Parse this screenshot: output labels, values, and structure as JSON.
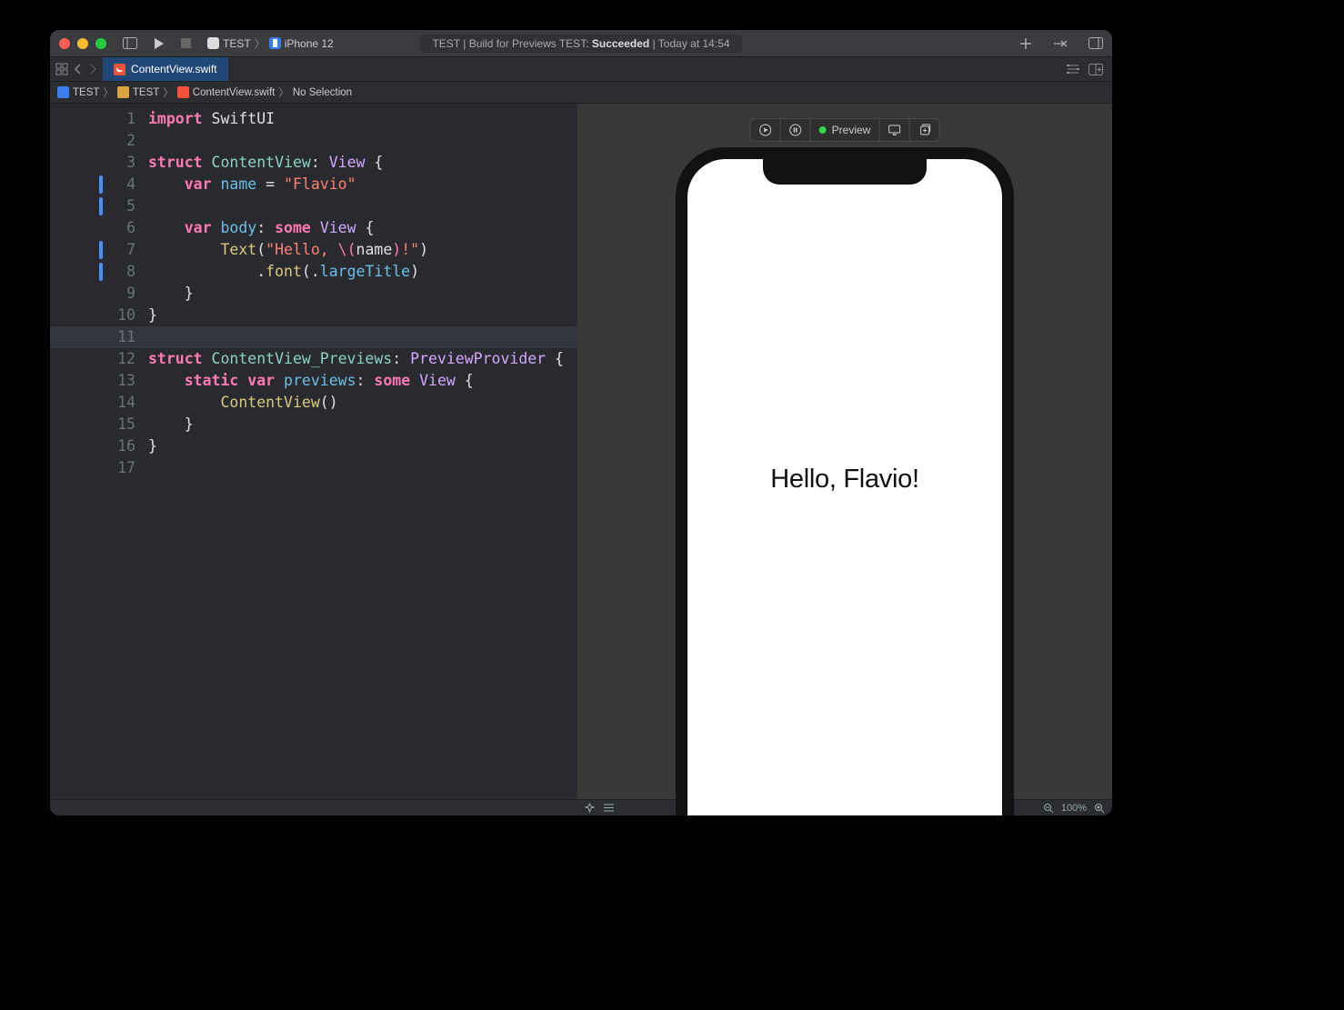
{
  "titlebar": {
    "scheme_target": "TEST",
    "scheme_device": "iPhone 12",
    "status_prefix": "TEST | Build for Previews TEST: ",
    "status_result": "Succeeded",
    "status_time": " | Today at 14:54"
  },
  "tabs": {
    "file_name": "ContentView.swift"
  },
  "breadcrumb": {
    "items": [
      "TEST",
      "TEST",
      "ContentView.swift",
      "No Selection"
    ]
  },
  "code": {
    "lines": [
      {
        "n": 1,
        "marker": false,
        "tokens": [
          [
            "kw",
            "import"
          ],
          [
            "plain",
            " "
          ],
          [
            "plain",
            "SwiftUI"
          ]
        ]
      },
      {
        "n": 2,
        "marker": false,
        "tokens": []
      },
      {
        "n": 3,
        "marker": false,
        "tokens": [
          [
            "kw",
            "struct"
          ],
          [
            "plain",
            " "
          ],
          [
            "ident",
            "ContentView"
          ],
          [
            "punct",
            ": "
          ],
          [
            "builtin-type",
            "View"
          ],
          [
            "punct",
            " {"
          ]
        ]
      },
      {
        "n": 4,
        "marker": true,
        "tokens": [
          [
            "plain",
            "    "
          ],
          [
            "kw",
            "var"
          ],
          [
            "plain",
            " "
          ],
          [
            "prop",
            "name"
          ],
          [
            "punct",
            " = "
          ],
          [
            "str",
            "\"Flavio\""
          ]
        ]
      },
      {
        "n": 5,
        "marker": true,
        "tokens": []
      },
      {
        "n": 6,
        "marker": false,
        "tokens": [
          [
            "plain",
            "    "
          ],
          [
            "kw",
            "var"
          ],
          [
            "plain",
            " "
          ],
          [
            "prop",
            "body"
          ],
          [
            "punct",
            ": "
          ],
          [
            "kw",
            "some"
          ],
          [
            "plain",
            " "
          ],
          [
            "builtin-type",
            "View"
          ],
          [
            "punct",
            " {"
          ]
        ]
      },
      {
        "n": 7,
        "marker": true,
        "tokens": [
          [
            "plain",
            "        "
          ],
          [
            "type",
            "Text"
          ],
          [
            "punct",
            "("
          ],
          [
            "str",
            "\"Hello, "
          ],
          [
            "strkw",
            "\\("
          ],
          [
            "plain",
            "name"
          ],
          [
            "strkw",
            ")"
          ],
          [
            "str",
            "!\""
          ],
          [
            "punct",
            ")"
          ]
        ]
      },
      {
        "n": 8,
        "marker": true,
        "tokens": [
          [
            "plain",
            "            "
          ],
          [
            "punct",
            "."
          ],
          [
            "type",
            "font"
          ],
          [
            "punct",
            "(."
          ],
          [
            "prop",
            "largeTitle"
          ],
          [
            "punct",
            ")"
          ]
        ]
      },
      {
        "n": 9,
        "marker": false,
        "tokens": [
          [
            "plain",
            "    "
          ],
          [
            "punct",
            "}"
          ]
        ]
      },
      {
        "n": 10,
        "marker": false,
        "tokens": [
          [
            "punct",
            "}"
          ]
        ]
      },
      {
        "n": 11,
        "marker": false,
        "hl": true,
        "tokens": []
      },
      {
        "n": 12,
        "marker": false,
        "tokens": [
          [
            "kw",
            "struct"
          ],
          [
            "plain",
            " "
          ],
          [
            "ident",
            "ContentView_Previews"
          ],
          [
            "punct",
            ": "
          ],
          [
            "builtin-type",
            "PreviewProvider"
          ],
          [
            "punct",
            " {"
          ]
        ]
      },
      {
        "n": 13,
        "marker": false,
        "tokens": [
          [
            "plain",
            "    "
          ],
          [
            "kw",
            "static"
          ],
          [
            "plain",
            " "
          ],
          [
            "kw",
            "var"
          ],
          [
            "plain",
            " "
          ],
          [
            "prop",
            "previews"
          ],
          [
            "punct",
            ": "
          ],
          [
            "kw",
            "some"
          ],
          [
            "plain",
            " "
          ],
          [
            "builtin-type",
            "View"
          ],
          [
            "punct",
            " {"
          ]
        ]
      },
      {
        "n": 14,
        "marker": false,
        "tokens": [
          [
            "plain",
            "        "
          ],
          [
            "type",
            "ContentView"
          ],
          [
            "punct",
            "()"
          ]
        ]
      },
      {
        "n": 15,
        "marker": false,
        "tokens": [
          [
            "plain",
            "    "
          ],
          [
            "punct",
            "}"
          ]
        ]
      },
      {
        "n": 16,
        "marker": false,
        "tokens": [
          [
            "punct",
            "}"
          ]
        ]
      },
      {
        "n": 17,
        "marker": false,
        "tokens": []
      }
    ]
  },
  "preview": {
    "label": "Preview",
    "phone_text": "Hello, Flavio!"
  },
  "bottombar": {
    "zoom": "100%"
  }
}
